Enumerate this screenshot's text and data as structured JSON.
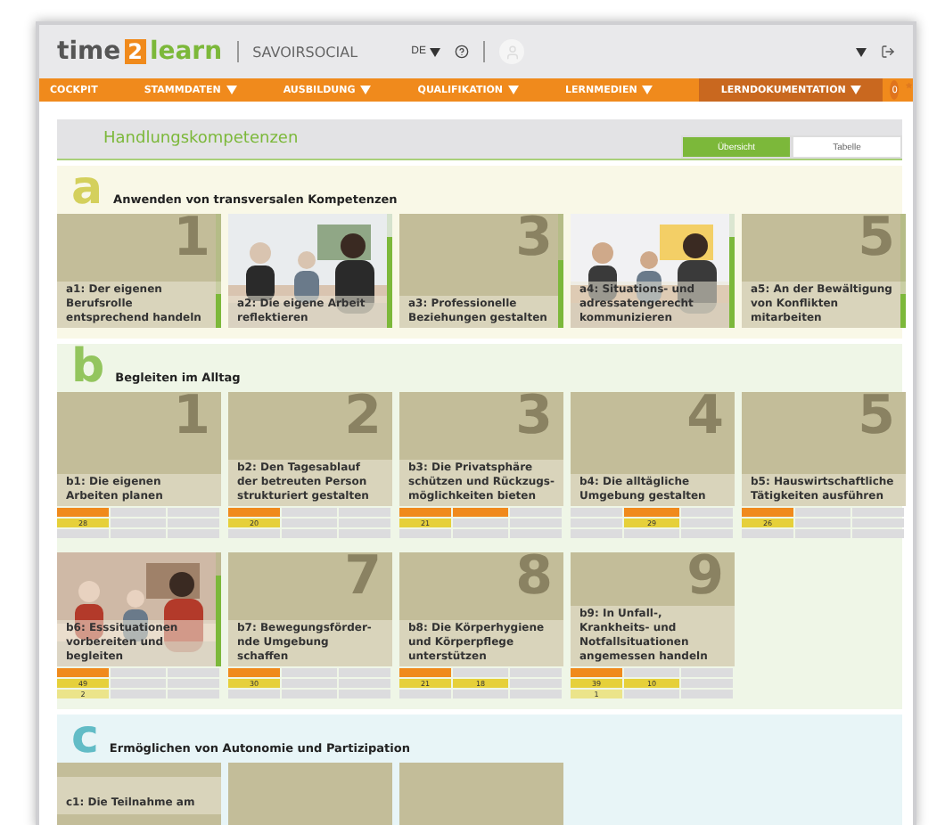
{
  "header": {
    "logo": {
      "part_1": "time",
      "part_2": "2",
      "part_3": "learn"
    },
    "product": "SAVOIRSOCIAL",
    "language": "DE"
  },
  "nav": {
    "items": [
      {
        "label": "COCKPIT",
        "dropdown": false,
        "selected": false
      },
      {
        "label": "STAMMDATEN",
        "dropdown": true,
        "selected": false
      },
      {
        "label": "AUSBILDUNG",
        "dropdown": true,
        "selected": false
      },
      {
        "label": "QUALIFIKATION",
        "dropdown": true,
        "selected": false
      },
      {
        "label": "LERNMEDIEN",
        "dropdown": true,
        "selected": false
      },
      {
        "label": "LERNDOKUMENTATION",
        "dropdown": true,
        "selected": true
      }
    ],
    "badge": "0"
  },
  "page": {
    "title": "Handlungskompetenzen",
    "tabs": [
      {
        "label": "Übersicht",
        "selected": true
      },
      {
        "label": "Tabelle",
        "selected": false
      }
    ]
  },
  "sections": [
    {
      "letter": "a",
      "color": "#d4d05c",
      "title": "Anwenden von transversalen Kompetenzen",
      "cards": [
        {
          "number": "1",
          "title": "a1: Der eigenen Berufsrolle entsprechend handeln",
          "level": 0.3
        },
        {
          "kind": "picture",
          "title": "a2: Die eigene Arbeit reflektieren",
          "level": 0.8
        },
        {
          "number": "3",
          "title": "a3: Professionelle Beziehungen gestalten",
          "level": 0.6
        },
        {
          "kind": "picture",
          "title": "a4: Situations- und adressatengerecht kommunizieren",
          "level": 0.8
        },
        {
          "number": "5",
          "title": "a5: An der Bewältigung von Konflikten mitarbeiten",
          "level": 0.3
        }
      ]
    },
    {
      "letter": "b",
      "color": "#93c55e",
      "title": "Begleiten im Alltag",
      "cards": [
        {
          "number": "1",
          "title": "b1: Die eigenen Arbeiten planen",
          "grid": [
            [
              {
                "kind": "orange"
              },
              {
                "kind": "empty"
              },
              {
                "kind": "empty"
              }
            ],
            [
              {
                "kind": "yellow",
                "text": "28"
              },
              {
                "kind": "empty"
              },
              {
                "kind": "empty"
              }
            ],
            [
              {
                "kind": "empty"
              },
              {
                "kind": "empty"
              },
              {
                "kind": "empty"
              }
            ]
          ]
        },
        {
          "number": "2",
          "title": "b2: Den Tagesablauf der betreuten Person strukturiert gestalten",
          "grid": [
            [
              {
                "kind": "orange"
              },
              {
                "kind": "empty"
              },
              {
                "kind": "empty"
              }
            ],
            [
              {
                "kind": "yellow",
                "text": "20"
              },
              {
                "kind": "empty"
              },
              {
                "kind": "empty"
              }
            ],
            [
              {
                "kind": "empty"
              },
              {
                "kind": "empty"
              },
              {
                "kind": "empty"
              }
            ]
          ]
        },
        {
          "number": "3",
          "title": "b3: Die Privatsphäre schützen und Rückzugs-möglichkeiten bieten",
          "grid": [
            [
              {
                "kind": "orange"
              },
              {
                "kind": "orange"
              },
              {
                "kind": "empty"
              }
            ],
            [
              {
                "kind": "yellow",
                "text": "21"
              },
              {
                "kind": "empty"
              },
              {
                "kind": "empty"
              }
            ],
            [
              {
                "kind": "empty"
              },
              {
                "kind": "empty"
              },
              {
                "kind": "empty"
              }
            ]
          ]
        },
        {
          "number": "4",
          "title": "b4: Die alltägliche Umgebung gestalten",
          "grid": [
            [
              {
                "kind": "empty"
              },
              {
                "kind": "orange"
              },
              {
                "kind": "empty"
              }
            ],
            [
              {
                "kind": "empty"
              },
              {
                "kind": "yellow",
                "text": "29"
              },
              {
                "kind": "empty"
              }
            ],
            [
              {
                "kind": "empty"
              },
              {
                "kind": "empty"
              },
              {
                "kind": "empty"
              }
            ]
          ]
        },
        {
          "number": "5",
          "title": "b5: Hauswirtschaftliche Tätigkeiten ausführen",
          "grid": [
            [
              {
                "kind": "orange"
              },
              {
                "kind": "empty"
              },
              {
                "kind": "empty"
              }
            ],
            [
              {
                "kind": "yellow",
                "text": "26"
              },
              {
                "kind": "empty"
              },
              {
                "kind": "empty"
              }
            ],
            [
              {
                "kind": "empty"
              },
              {
                "kind": "empty"
              },
              {
                "kind": "empty"
              }
            ]
          ]
        },
        {
          "kind": "picture",
          "title": "b6: Esssituationen vorbereiten und begleiten",
          "level": 0.8,
          "grid": [
            [
              {
                "kind": "orange"
              },
              {
                "kind": "empty"
              },
              {
                "kind": "empty"
              }
            ],
            [
              {
                "kind": "yellow",
                "text": "49"
              },
              {
                "kind": "empty"
              },
              {
                "kind": "empty"
              }
            ],
            [
              {
                "kind": "pale",
                "text": "2"
              },
              {
                "kind": "empty"
              },
              {
                "kind": "empty"
              }
            ]
          ]
        },
        {
          "number": "7",
          "title": "b7: Bewegungsförder-nde Umgebung schaffen",
          "grid": [
            [
              {
                "kind": "orange"
              },
              {
                "kind": "empty"
              },
              {
                "kind": "empty"
              }
            ],
            [
              {
                "kind": "yellow",
                "text": "30"
              },
              {
                "kind": "empty"
              },
              {
                "kind": "empty"
              }
            ],
            [
              {
                "kind": "empty"
              },
              {
                "kind": "empty"
              },
              {
                "kind": "empty"
              }
            ]
          ]
        },
        {
          "number": "8",
          "title": "b8: Die Körperhygiene und Körperpflege unterstützen",
          "grid": [
            [
              {
                "kind": "orange"
              },
              {
                "kind": "empty"
              },
              {
                "kind": "empty"
              }
            ],
            [
              {
                "kind": "yellow",
                "text": "21"
              },
              {
                "kind": "yellow",
                "text": "18"
              },
              {
                "kind": "empty"
              }
            ],
            [
              {
                "kind": "empty"
              },
              {
                "kind": "empty"
              },
              {
                "kind": "empty"
              }
            ]
          ]
        },
        {
          "number": "9",
          "title": "b9: In Unfall-, Krankheits- und Notfallsituationen angemessen handeln",
          "grid": [
            [
              {
                "kind": "orange"
              },
              {
                "kind": "empty"
              },
              {
                "kind": "empty"
              }
            ],
            [
              {
                "kind": "yellow",
                "text": "39"
              },
              {
                "kind": "yellow",
                "text": "10"
              },
              {
                "kind": "empty"
              }
            ],
            [
              {
                "kind": "pale",
                "text": "1"
              },
              {
                "kind": "empty"
              },
              {
                "kind": "empty"
              }
            ]
          ]
        }
      ]
    },
    {
      "letter": "c",
      "color": "#62bcc6",
      "title": "Ermöglichen von Autonomie und Partizipation",
      "cards": [
        {
          "kind": "plain",
          "title": "c1: Die Teilnahme am"
        },
        {
          "kind": "plain"
        },
        {
          "kind": "plain"
        }
      ]
    }
  ]
}
